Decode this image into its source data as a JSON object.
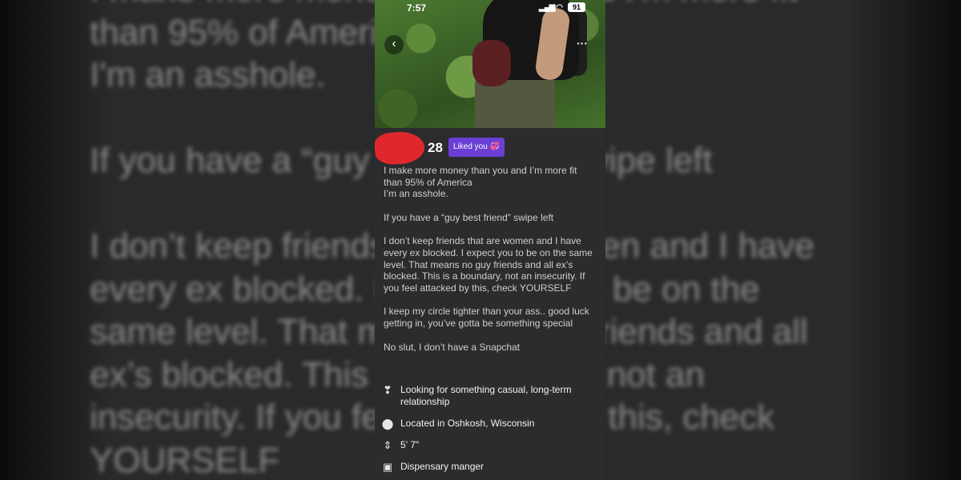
{
  "background_text": "I make more money than you and I'm more fit\nthan 95% of America\nI'm an asshole.\n\nIf you have a “guy best friend” swipe left\n\nI don’t keep friends that are women and I have\nevery ex blocked. I expect you to be on the\nsame level. That means no guy friends and all\nex’s blocked. This is a boundary, not an\ninsecurity. If you feel attacked by this, check\nYOURSELF",
  "status": {
    "time": "7:57",
    "battery": "91"
  },
  "profile": {
    "age": "28",
    "liked_badge": "Liked you 💞",
    "bio": [
      "I make more money than you and I’m more fit than 95% of America\nI’m an asshole.",
      "If you have a “guy best friend” swipe left",
      "I don’t keep friends that are women and I have every ex blocked. I expect you to be on the same level. That means no guy friends and all ex’s blocked. This is a boundary, not an insecurity. If you feel attacked by this, check YOURSELF",
      "I keep my circle tighter than your ass.. good luck getting in, you’ve gotta be something special",
      "No slut, I don’t have a Snapchat"
    ],
    "details": [
      {
        "icon": "relationship-icon",
        "text": "Looking for something casual, long-term relationship"
      },
      {
        "icon": "location-pin-icon",
        "text": "Located in Oshkosh, Wisconsin"
      },
      {
        "icon": "height-icon",
        "text": "5’ 7\""
      },
      {
        "icon": "briefcase-icon",
        "text": "Dispensary manger"
      }
    ]
  },
  "colors": {
    "liked_badge": "#6b3fd6",
    "redaction": "#e0282c",
    "panel_bg": "#2c2c2e"
  }
}
